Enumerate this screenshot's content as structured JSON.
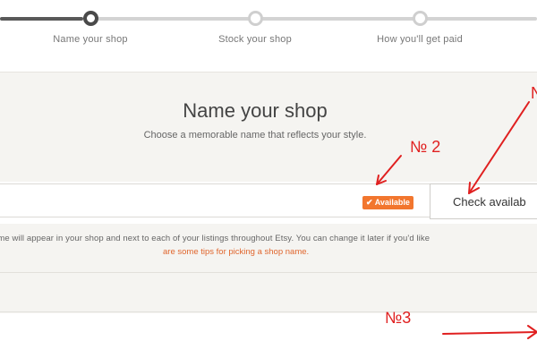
{
  "stepper": {
    "steps": [
      {
        "label": "Name your shop"
      },
      {
        "label": "Stock your shop"
      },
      {
        "label": "How you'll get paid"
      }
    ]
  },
  "header": {
    "title": "Name your shop",
    "subtitle": "Choose a memorable name that reflects your style."
  },
  "shop_name_field": {
    "value": "",
    "availability_badge": "Available",
    "check_button_label": "Check availab"
  },
  "help": {
    "text": "ame will appear in your shop and next to each of your listings throughout Etsy. You can change it later if you'd like",
    "link": "are some tips for picking a shop name."
  },
  "annotations": {
    "label_1": "N",
    "label_2": "№ 2",
    "label_3": "№3",
    "color": "#e02020"
  },
  "colors": {
    "accent": "#f2762e",
    "link": "#e0662e",
    "band": "#f5f4f1"
  }
}
